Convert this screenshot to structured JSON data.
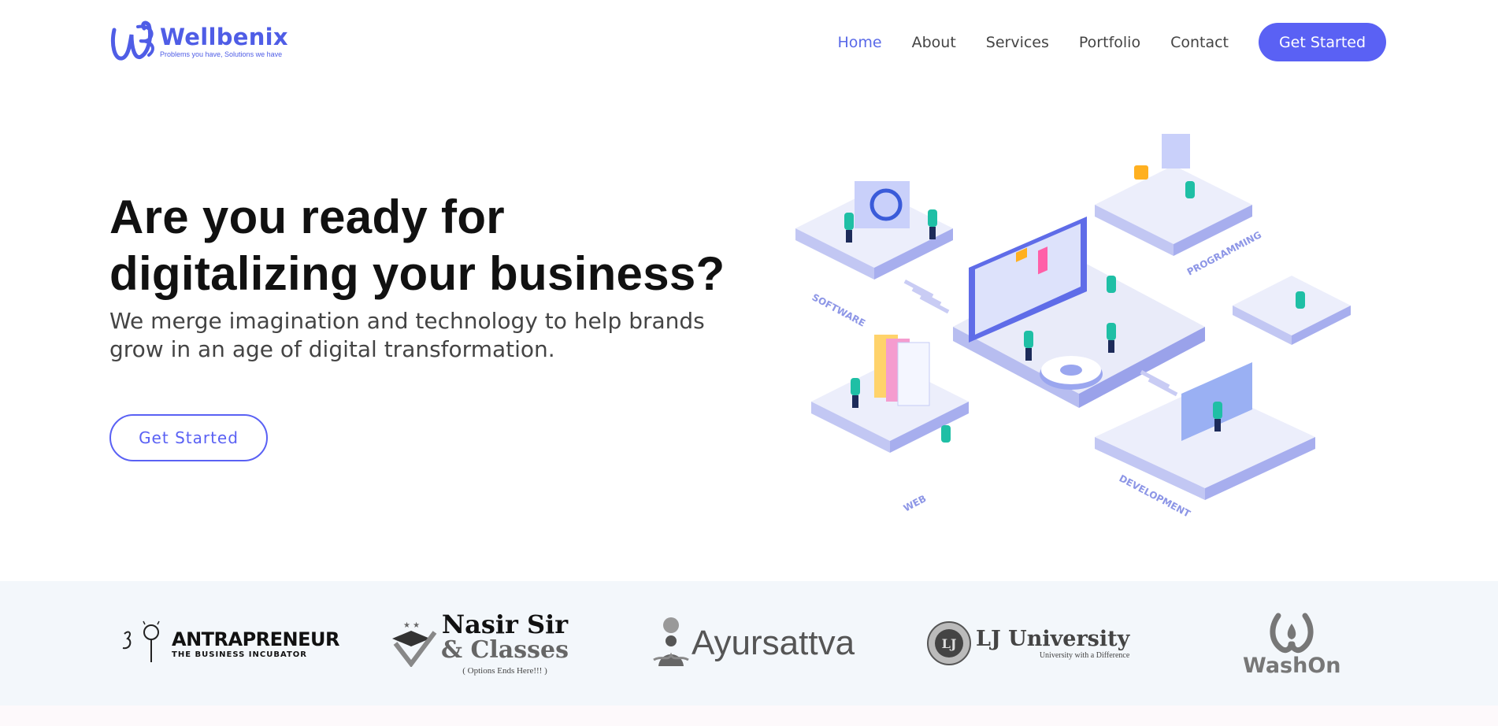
{
  "brand": {
    "name": "Wellbenix",
    "tagline": "Problems you have, Solutions we have",
    "accent": "#5a61f4"
  },
  "nav": {
    "items": [
      {
        "label": "Home",
        "active": true
      },
      {
        "label": "About"
      },
      {
        "label": "Services"
      },
      {
        "label": "Portfolio"
      },
      {
        "label": "Contact"
      }
    ],
    "cta": "Get Started"
  },
  "hero": {
    "title_line1": "Are you ready for",
    "title_line2": "digitalizing your business?",
    "subtitle_line1": "We merge imagination and technology to help brands",
    "subtitle_line2": "grow in an age of digital transformation.",
    "cta": "Get Started",
    "illustration_labels": {
      "software": "SOFTWARE",
      "programming": "PROGRAMMING",
      "web": "WEB",
      "development": "DEVELOPMENT"
    }
  },
  "clients": [
    {
      "name": "ANTRAPRENEUR",
      "sub": "THE BUSINESS INCUBATOR",
      "icon": "bulb-icon"
    },
    {
      "name_line1": "Nasir Sir",
      "name_line2": "& Classes",
      "sub": "( Options Ends Here!!! )",
      "icon": "graduation-cap-icon"
    },
    {
      "name": "Ayursattva",
      "icon": "tree-person-icon"
    },
    {
      "name": "LJ University",
      "sub": "University with a Difference",
      "icon": "shield-seal-icon"
    },
    {
      "name": "WashOn",
      "icon": "water-drop-icon"
    }
  ]
}
